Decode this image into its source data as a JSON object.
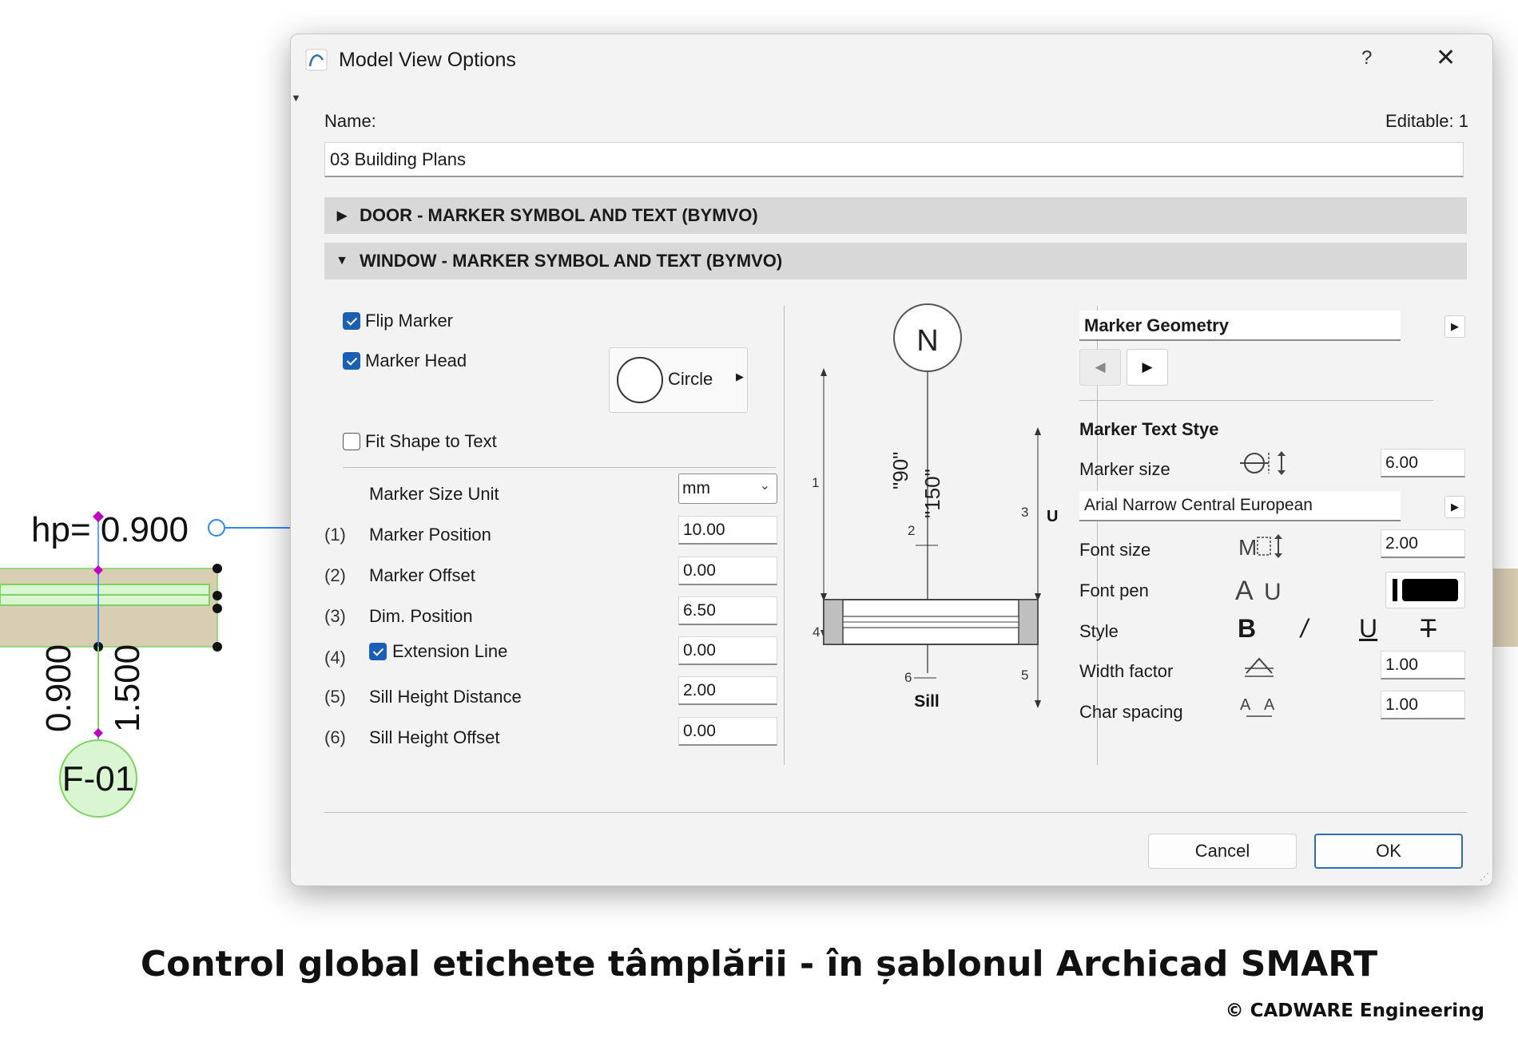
{
  "drawing": {
    "hp_label": "hp= 0.900",
    "dim_1": "0.900",
    "dim_2": "1.500",
    "tag": "F-01"
  },
  "dialog": {
    "title": "Model View Options",
    "help": "?",
    "close": "✕",
    "name_label": "Name:",
    "editable_label": "Editable: 1",
    "name_value": "03 Building Plans",
    "sections": [
      {
        "label": "DOOR - MARKER SYMBOL AND TEXT (BYMVO)",
        "expanded": false
      },
      {
        "label": "WINDOW - MARKER SYMBOL AND TEXT (BYMVO)",
        "expanded": true
      }
    ],
    "left": {
      "flip_marker": {
        "label": "Flip Marker",
        "checked": true
      },
      "marker_head": {
        "label": "Marker Head",
        "checked": true
      },
      "shape": "Circle",
      "fit_shape": {
        "label": "Fit Shape to Text",
        "checked": false
      },
      "unit_label": "Marker Size Unit",
      "unit_value": "mm",
      "params": [
        {
          "num": "(1)",
          "label": "Marker Position",
          "value": "10.00"
        },
        {
          "num": "(2)",
          "label": "Marker Offset",
          "value": "0.00"
        },
        {
          "num": "(3)",
          "label": "Dim. Position",
          "value": "6.50"
        },
        {
          "num": "(4)",
          "label": "Extension Line",
          "value": "0.00",
          "checked": true
        },
        {
          "num": "(5)",
          "label": "Sill Height Distance",
          "value": "2.00"
        },
        {
          "num": "(6)",
          "label": "Sill Height Offset",
          "value": "0.00"
        }
      ]
    },
    "preview": {
      "marker_letter": "N",
      "dim_a": "\"90\"",
      "dim_b": "\"150\"",
      "n1": "1",
      "n2": "2",
      "n3": "3",
      "n4": "4",
      "n5": "5",
      "n6": "6",
      "u_label": "U",
      "sill_label": "Sill"
    },
    "right": {
      "geometry_title": "Marker Geometry",
      "text_style_title": "Marker Text Stye",
      "marker_size_label": "Marker size",
      "marker_size_value": "6.00",
      "font_name": "Arial Narrow Central European",
      "font_size_label": "Font size",
      "font_size_value": "2.00",
      "font_pen_label": "Font pen",
      "style_label": "Style",
      "width_factor_label": "Width factor",
      "width_factor_value": "1.00",
      "char_spacing_label": "Char spacing",
      "char_spacing_value": "1.00",
      "pen_color": "#000000"
    },
    "buttons": {
      "cancel": "Cancel",
      "ok": "OK"
    }
  },
  "caption": "Control global etichete tâmplării - în șablonul Archicad SMART",
  "copyright": "© CADWARE Engineering",
  "colors": {
    "accent": "#1a5fb4",
    "wall": "#d8ceb4",
    "window_green": "#7ed35f",
    "tag_green": "#d9f5d2",
    "magenta": "#c000c0"
  }
}
